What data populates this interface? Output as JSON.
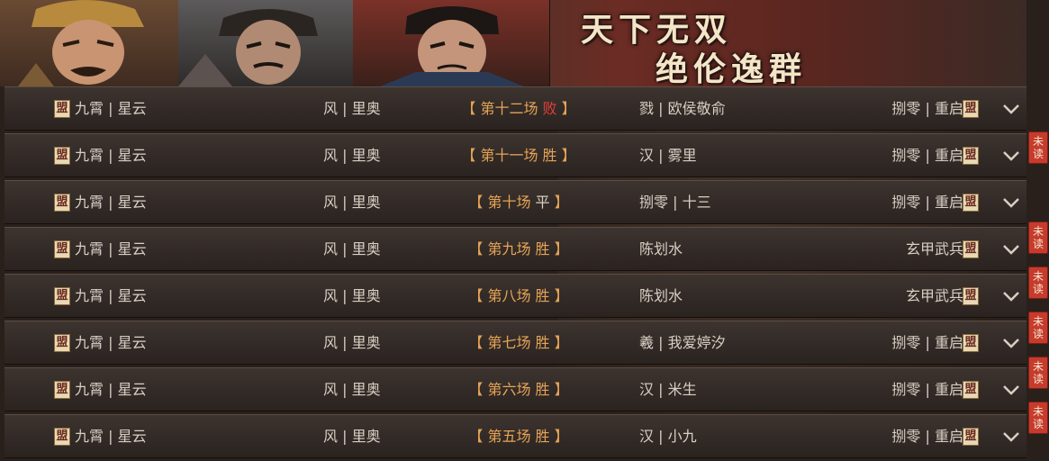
{
  "banner": {
    "slogan_line1": "天下无双",
    "slogan_line2": "绝伦逸群"
  },
  "alliance_icon_glyph": "盟",
  "unread_label": "未读",
  "rows": [
    {
      "left_name": "九霄 | 星云",
      "left_mid": "风 | 里奥",
      "result_open": "【 ",
      "result_round": "第十二场 ",
      "result_outcome": "败",
      "result_close": " 】",
      "outcome_type": "lose",
      "opponent": "戮 | 欧侯敬俞",
      "opponent_guild": "捌零 | 重启",
      "unread": false
    },
    {
      "left_name": "九霄 | 星云",
      "left_mid": "风 | 里奥",
      "result_open": "【 ",
      "result_round": "第十一场 ",
      "result_outcome": "胜",
      "result_close": " 】",
      "outcome_type": "win",
      "opponent": "汉 | 雾里",
      "opponent_guild": "捌零 | 重启",
      "unread": true
    },
    {
      "left_name": "九霄 | 星云",
      "left_mid": "风 | 里奥",
      "result_open": "【 ",
      "result_round": "第十场 ",
      "result_outcome": "平",
      "result_close": " 】",
      "outcome_type": "draw",
      "opponent": "捌零 | 十三",
      "opponent_guild": "捌零 | 重启",
      "unread": false
    },
    {
      "left_name": "九霄 | 星云",
      "left_mid": "风 | 里奥",
      "result_open": "【 ",
      "result_round": "第九场 ",
      "result_outcome": "胜",
      "result_close": " 】",
      "outcome_type": "win",
      "opponent": "陈划水",
      "opponent_guild": "玄甲武兵",
      "unread": true
    },
    {
      "left_name": "九霄 | 星云",
      "left_mid": "风 | 里奥",
      "result_open": "【 ",
      "result_round": "第八场 ",
      "result_outcome": "胜",
      "result_close": " 】",
      "outcome_type": "win",
      "opponent": "陈划水",
      "opponent_guild": "玄甲武兵",
      "unread": true
    },
    {
      "left_name": "九霄 | 星云",
      "left_mid": "风 | 里奥",
      "result_open": "【 ",
      "result_round": "第七场 ",
      "result_outcome": "胜",
      "result_close": " 】",
      "outcome_type": "win",
      "opponent": "羲 | 我爱婷汐",
      "opponent_guild": "捌零 | 重启",
      "unread": true
    },
    {
      "left_name": "九霄 | 星云",
      "left_mid": "风 | 里奥",
      "result_open": "【 ",
      "result_round": "第六场 ",
      "result_outcome": "胜",
      "result_close": " 】",
      "outcome_type": "win",
      "opponent": "汉 | 米生",
      "opponent_guild": "捌零 | 重启",
      "unread": true
    },
    {
      "left_name": "九霄 | 星云",
      "left_mid": "风 | 里奥",
      "result_open": "【 ",
      "result_round": "第五场 ",
      "result_outcome": "胜",
      "result_close": " 】",
      "outcome_type": "win",
      "opponent": "汉 | 小九",
      "opponent_guild": "捌零 | 重启",
      "unread": true
    }
  ]
}
